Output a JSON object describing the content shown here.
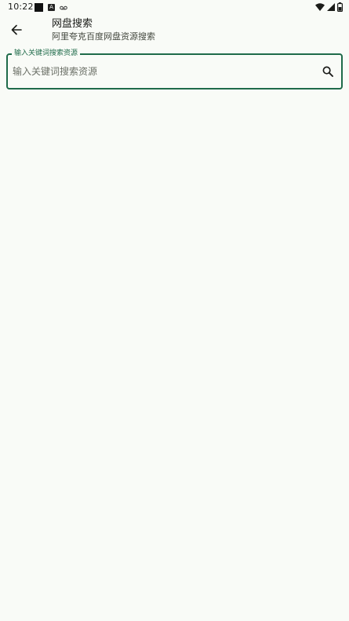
{
  "status_bar": {
    "time": "10:22",
    "left_icons": [
      "square-notification-icon",
      "a-notification-icon",
      "voicemail-icon"
    ],
    "right_icons": [
      "wifi-icon",
      "cell-signal-icon",
      "battery-icon"
    ]
  },
  "app_bar": {
    "back_icon": "arrow-back-icon",
    "title": "网盘搜索",
    "subtitle": "阿里夸克百度网盘资源搜索"
  },
  "search": {
    "label": "输入关键词搜索资源",
    "placeholder": "输入关键词搜索资源",
    "value": "",
    "icon": "search-icon"
  },
  "colors": {
    "background": "#f9fbf7",
    "accent": "#1f6b4a",
    "text": "#1b1c19",
    "secondary_text": "#44483f"
  }
}
